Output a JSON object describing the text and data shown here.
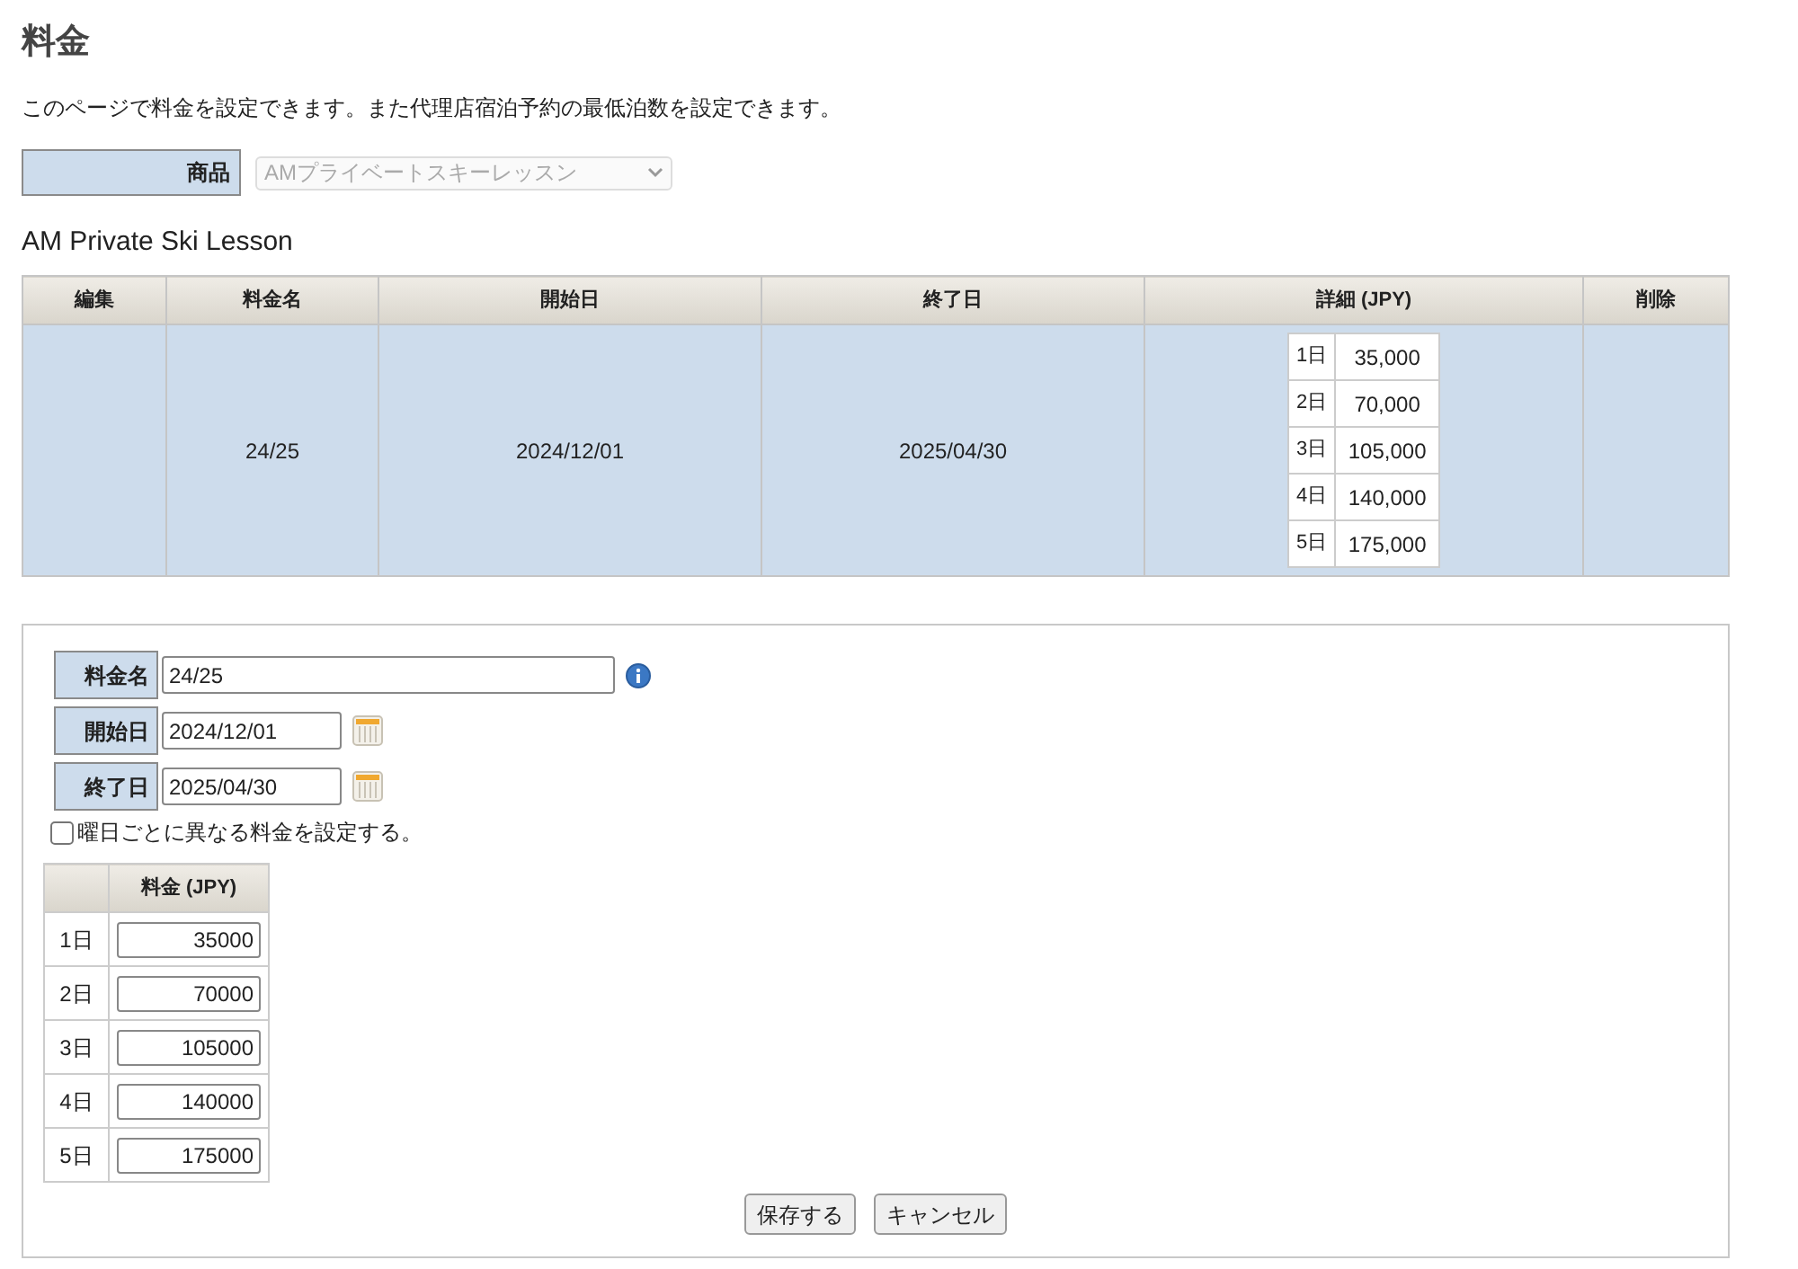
{
  "page": {
    "title": "料金",
    "description": "このページで料金を設定できます。また代理店宿泊予約の最低泊数を設定できます。"
  },
  "product": {
    "label": "商品",
    "value": "AMプライベートスキーレッスン",
    "disabled": true
  },
  "section_title": "AM Private Ski Lesson",
  "rates_table": {
    "columns": [
      "編集",
      "料金名",
      "開始日",
      "終了日",
      "詳細 (JPY)",
      "削除"
    ],
    "rows": [
      {
        "name": "24/25",
        "start": "2024/12/01",
        "end": "2025/04/30",
        "details": [
          {
            "day": "1日",
            "price": "35,000"
          },
          {
            "day": "2日",
            "price": "70,000"
          },
          {
            "day": "3日",
            "price": "105,000"
          },
          {
            "day": "4日",
            "price": "140,000"
          },
          {
            "day": "5日",
            "price": "175,000"
          }
        ]
      }
    ]
  },
  "form": {
    "fields": [
      {
        "label": "料金名",
        "value": "24/25",
        "kind": "text"
      },
      {
        "label": "開始日",
        "value": "2024/12/01",
        "kind": "date"
      },
      {
        "label": "終了日",
        "value": "2025/04/30",
        "kind": "date"
      }
    ],
    "weekday_option": {
      "label": "曜日ごとに異なる料金を設定する。",
      "checked": false
    },
    "price_table": {
      "column": "料金 (JPY)",
      "rows": [
        {
          "day": "1日",
          "value": "35000"
        },
        {
          "day": "2日",
          "value": "70000"
        },
        {
          "day": "3日",
          "value": "105000"
        },
        {
          "day": "4日",
          "value": "140000"
        },
        {
          "day": "5日",
          "value": "175000"
        }
      ]
    },
    "buttons": [
      "保存する",
      "キャンセル"
    ]
  }
}
